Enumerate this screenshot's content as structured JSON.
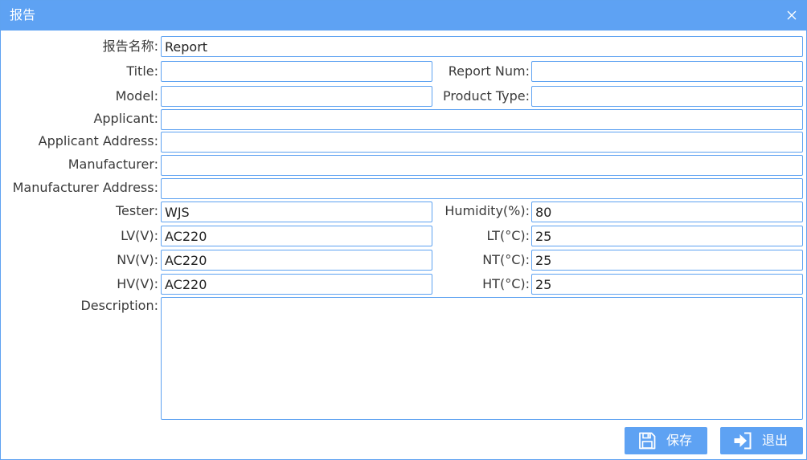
{
  "window": {
    "title": "报告",
    "close_icon": "close-icon"
  },
  "form": {
    "report_name": {
      "label": "报告名称:",
      "value": "Report"
    },
    "title": {
      "label": "Title:",
      "value": ""
    },
    "report_num": {
      "label": "Report Num:",
      "value": ""
    },
    "model": {
      "label": "Model:",
      "value": ""
    },
    "product_type": {
      "label": "Product Type:",
      "value": ""
    },
    "applicant": {
      "label": "Applicant:",
      "value": ""
    },
    "applicant_address": {
      "label": "Applicant Address:",
      "value": ""
    },
    "manufacturer": {
      "label": "Manufacturer:",
      "value": ""
    },
    "manufacturer_address": {
      "label": "Manufacturer Address:",
      "value": ""
    },
    "tester": {
      "label": "Tester:",
      "value": "WJS"
    },
    "humidity": {
      "label": "Humidity(%):",
      "value": "80"
    },
    "lv": {
      "label": "LV(V):",
      "value": "AC220"
    },
    "lt": {
      "label": "LT(°C):",
      "value": "25"
    },
    "nv": {
      "label": "NV(V):",
      "value": "AC220"
    },
    "nt": {
      "label": "NT(°C):",
      "value": "25"
    },
    "hv": {
      "label": "HV(V):",
      "value": "AC220"
    },
    "ht": {
      "label": "HT(°C):",
      "value": "25"
    },
    "description": {
      "label": "Description:",
      "value": ""
    }
  },
  "buttons": {
    "save": {
      "label": "保存",
      "icon": "save-icon"
    },
    "exit": {
      "label": "退出",
      "icon": "exit-icon"
    }
  },
  "colors": {
    "accent": "#5ea2f3",
    "field_border": "#5ea2f1",
    "text": "#3a3a3a"
  }
}
